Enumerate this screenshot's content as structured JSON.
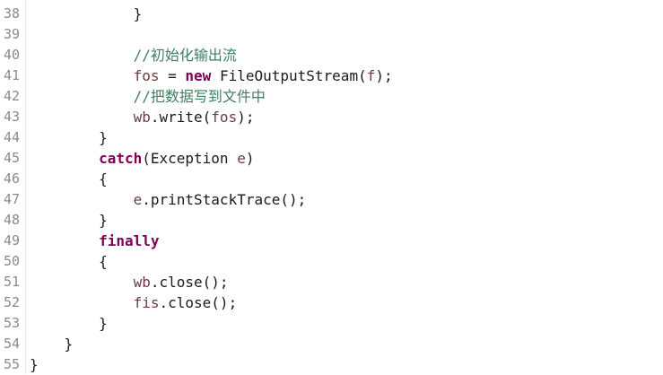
{
  "colors": {
    "keyword": "#7f0055",
    "comment": "#3f7f5f",
    "variable": "#6a3e3e",
    "text": "#1a1a1a",
    "line_number": "#8a8a8a",
    "background": "#ffffff"
  },
  "lines": [
    {
      "n": "38",
      "indent": "            ",
      "tokens": [
        {
          "t": "}",
          "c": ""
        }
      ]
    },
    {
      "n": "39",
      "indent": "",
      "tokens": []
    },
    {
      "n": "40",
      "indent": "            ",
      "tokens": [
        {
          "t": "//初始化输出流",
          "c": "cm"
        }
      ]
    },
    {
      "n": "41",
      "indent": "            ",
      "tokens": [
        {
          "t": "fos",
          "c": "var"
        },
        {
          "t": " = ",
          "c": ""
        },
        {
          "t": "new",
          "c": "kw"
        },
        {
          "t": " FileOutputStream(",
          "c": ""
        },
        {
          "t": "f",
          "c": "var"
        },
        {
          "t": ");",
          "c": ""
        }
      ]
    },
    {
      "n": "42",
      "indent": "            ",
      "tokens": [
        {
          "t": "//把数据写到文件中",
          "c": "cm"
        }
      ]
    },
    {
      "n": "43",
      "indent": "            ",
      "tokens": [
        {
          "t": "wb",
          "c": "var"
        },
        {
          "t": ".write(",
          "c": ""
        },
        {
          "t": "fos",
          "c": "var"
        },
        {
          "t": ");",
          "c": ""
        }
      ]
    },
    {
      "n": "44",
      "indent": "        ",
      "tokens": [
        {
          "t": "}",
          "c": ""
        }
      ]
    },
    {
      "n": "45",
      "indent": "        ",
      "tokens": [
        {
          "t": "catch",
          "c": "kw"
        },
        {
          "t": "(Exception ",
          "c": ""
        },
        {
          "t": "e",
          "c": "var"
        },
        {
          "t": ")",
          "c": ""
        }
      ]
    },
    {
      "n": "46",
      "indent": "        ",
      "tokens": [
        {
          "t": "{",
          "c": ""
        }
      ]
    },
    {
      "n": "47",
      "indent": "            ",
      "tokens": [
        {
          "t": "e",
          "c": "var"
        },
        {
          "t": ".printStackTrace();",
          "c": ""
        }
      ]
    },
    {
      "n": "48",
      "indent": "        ",
      "tokens": [
        {
          "t": "}",
          "c": ""
        }
      ]
    },
    {
      "n": "49",
      "indent": "        ",
      "tokens": [
        {
          "t": "finally",
          "c": "kw"
        }
      ]
    },
    {
      "n": "50",
      "indent": "        ",
      "tokens": [
        {
          "t": "{",
          "c": ""
        }
      ]
    },
    {
      "n": "51",
      "indent": "            ",
      "tokens": [
        {
          "t": "wb",
          "c": "var"
        },
        {
          "t": ".close();",
          "c": ""
        }
      ]
    },
    {
      "n": "52",
      "indent": "            ",
      "tokens": [
        {
          "t": "fis",
          "c": "var"
        },
        {
          "t": ".close();",
          "c": ""
        }
      ]
    },
    {
      "n": "53",
      "indent": "        ",
      "tokens": [
        {
          "t": "}",
          "c": ""
        }
      ]
    },
    {
      "n": "54",
      "indent": "    ",
      "tokens": [
        {
          "t": "}",
          "c": ""
        }
      ]
    },
    {
      "n": "55",
      "indent": "",
      "tokens": [
        {
          "t": "}",
          "c": ""
        }
      ]
    }
  ]
}
